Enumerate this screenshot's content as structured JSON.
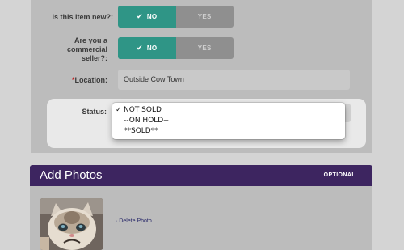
{
  "form": {
    "new_item": {
      "label": "Is this item new?:",
      "yes": "YES",
      "no": "NO",
      "selected": "NO"
    },
    "commercial": {
      "label_line1": "Are you a",
      "label_line2": "commercial",
      "label_line3": "seller?:",
      "yes": "YES",
      "no": "NO",
      "selected": "NO"
    },
    "location": {
      "required_mark": "*",
      "label": "Location:",
      "value": "Outside Cow Town"
    },
    "status": {
      "label": "Status:",
      "faint_text": "",
      "options": [
        "NOT SOLD",
        "--ON HOLD--",
        "**SOLD**"
      ],
      "selected": "NOT SOLD",
      "tick": "✓"
    }
  },
  "photos": {
    "title": "Add Photos",
    "optional_label": "OPTIONAL",
    "delete_link": "Delete Photo",
    "thumbnail_icon": "cat-photo"
  },
  "colors": {
    "toggle_on": "#2f9586",
    "toggle_off": "#8f8f8f",
    "header_purple": "#3d2560",
    "required": "#c02020"
  }
}
